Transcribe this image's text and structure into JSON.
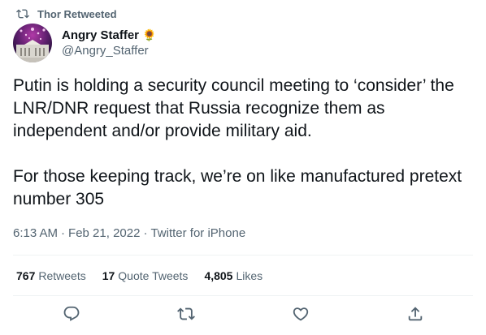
{
  "retweet_context": {
    "text": "Thor Retweeted"
  },
  "author": {
    "display_name": "Angry Staffer",
    "emoji": "🌻",
    "handle": "@Angry_Staffer"
  },
  "tweet": {
    "paragraph_1": "Putin is holding a security council meeting to ‘consider’ the LNR/DNR request that Russia recognize them as independent and/or provide military aid.",
    "paragraph_2": "For those keeping track, we’re on like manufactured pretext number 305"
  },
  "meta": {
    "time": "6:13 AM",
    "separator_1": "·",
    "date": "Feb 21, 2022",
    "separator_2": "·",
    "source": "Twitter for iPhone"
  },
  "stats": {
    "retweets_count": "767",
    "retweets_label": "Retweets",
    "quote_count": "17",
    "quote_label": "Quote Tweets",
    "likes_count": "4,805",
    "likes_label": "Likes"
  },
  "actions": {
    "reply_icon": "reply-icon",
    "retweet_icon": "retweet-icon",
    "like_icon": "like-icon",
    "share_icon": "share-icon"
  },
  "colors": {
    "primary_text": "#0f1419",
    "secondary_text": "#536471",
    "divider": "#eff3f4",
    "background": "#ffffff"
  }
}
